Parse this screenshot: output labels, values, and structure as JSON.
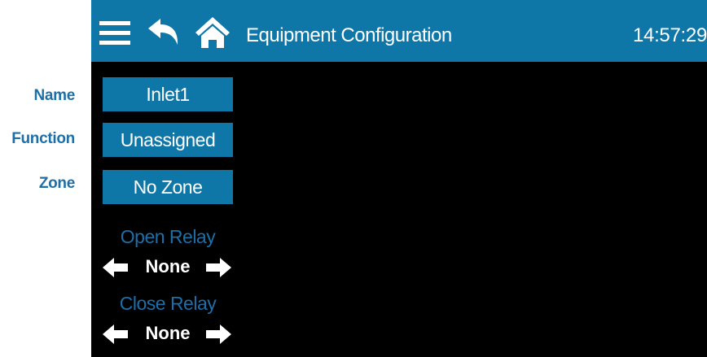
{
  "header": {
    "title": "Equipment Configuration",
    "time": "14:57:29"
  },
  "labels": {
    "name": "Name",
    "function": "Function",
    "zone": "Zone"
  },
  "fields": {
    "name_value": "Inlet1",
    "function_value": "Unassigned",
    "zone_value": "No Zone"
  },
  "open_relay": {
    "title": "Open Relay",
    "value": "None"
  },
  "close_relay": {
    "title": "Close Relay",
    "value": "None"
  },
  "icons": [
    "menu-icon",
    "back-arrow-icon",
    "home-icon",
    "left-arrow-icon",
    "right-arrow-icon"
  ],
  "colors": {
    "accent": "#0f77a8",
    "label": "#1d6fa8",
    "background": "#000000"
  }
}
